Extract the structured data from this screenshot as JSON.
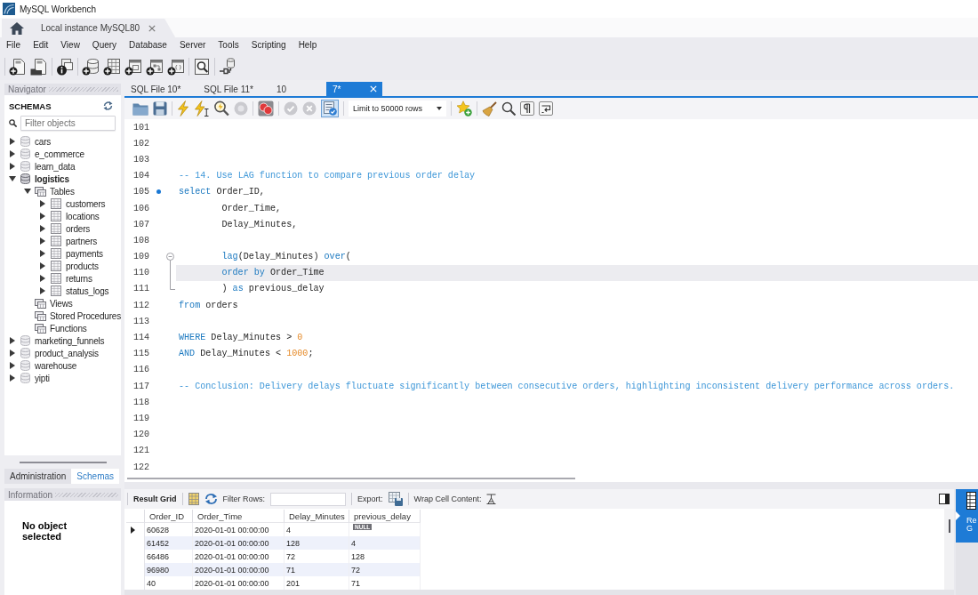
{
  "window": {
    "title": "MySQL Workbench"
  },
  "connection_tabs": [
    {
      "label": "Local instance MySQL80",
      "selected": true
    }
  ],
  "menu": [
    "File",
    "Edit",
    "View",
    "Query",
    "Database",
    "Server",
    "Tools",
    "Scripting",
    "Help"
  ],
  "navigator": {
    "title": "Navigator",
    "section_title": "SCHEMAS",
    "filter": {
      "placeholder": "Filter objects"
    },
    "schemas": [
      {
        "label": "cars",
        "kind": "schema",
        "expanded": false,
        "default": false
      },
      {
        "label": "e_commerce",
        "kind": "schema",
        "expanded": false,
        "default": false
      },
      {
        "label": "learn_data",
        "kind": "schema",
        "expanded": false,
        "default": false
      },
      {
        "label": "logistics",
        "kind": "schema",
        "expanded": true,
        "default": true,
        "children": [
          {
            "label": "Tables",
            "kind": "folder",
            "expanded": true,
            "children": [
              {
                "label": "customers",
                "kind": "table",
                "expanded": false
              },
              {
                "label": "locations",
                "kind": "table",
                "expanded": false
              },
              {
                "label": "orders",
                "kind": "table",
                "expanded": false
              },
              {
                "label": "partners",
                "kind": "table",
                "expanded": false
              },
              {
                "label": "payments",
                "kind": "table",
                "expanded": false
              },
              {
                "label": "products",
                "kind": "table",
                "expanded": false
              },
              {
                "label": "returns",
                "kind": "table",
                "expanded": false
              },
              {
                "label": "status_logs",
                "kind": "table",
                "expanded": false
              }
            ]
          },
          {
            "label": "Views",
            "kind": "empty-folder"
          },
          {
            "label": "Stored Procedures",
            "kind": "empty-folder"
          },
          {
            "label": "Functions",
            "kind": "empty-folder"
          }
        ]
      },
      {
        "label": "marketing_funnels",
        "kind": "schema",
        "expanded": false,
        "default": false
      },
      {
        "label": "product_analysis",
        "kind": "schema",
        "expanded": false,
        "default": false
      },
      {
        "label": "warehouse",
        "kind": "schema",
        "expanded": false,
        "default": false
      },
      {
        "label": "yipti",
        "kind": "schema",
        "expanded": false,
        "default": false
      }
    ],
    "bottom_tabs": [
      {
        "label": "Administration",
        "selected": false
      },
      {
        "label": "Schemas",
        "selected": true
      }
    ]
  },
  "information": {
    "title": "Information",
    "message": "No object selected"
  },
  "editor_tabs": [
    {
      "label": "SQL File 10*",
      "selected": false
    },
    {
      "label": "SQL File 11*",
      "selected": false
    },
    {
      "label": "10",
      "selected": false
    },
    {
      "label": "7*",
      "selected": true
    }
  ],
  "editor_toolbar": {
    "stop_disabled": true,
    "commit_disabled": true,
    "rollback_disabled": true,
    "autocommit_on": true,
    "row_limit": "Limit to 50000 rows"
  },
  "editor": {
    "lines": [
      {
        "number": "101",
        "kind": "plain",
        "current": false
      },
      {
        "number": "102",
        "kind": "plain",
        "current": false
      },
      {
        "number": "103",
        "kind": "plain",
        "current": false
      },
      {
        "number": "104",
        "kind": "plain",
        "current": false,
        "indented": false,
        "tokens": [
          {
            "kind": "comment",
            "text": "-- 14. Use LAG function to compare previous order delay"
          }
        ]
      },
      {
        "number": "105",
        "kind": "statement",
        "current": false,
        "indented": false,
        "tokens": [
          {
            "kind": "keyword",
            "text": "select"
          },
          {
            "kind": "plain",
            "text": " Order_ID,"
          }
        ]
      },
      {
        "number": "106",
        "kind": "plain",
        "current": false,
        "indented": true,
        "tokens": [
          {
            "kind": "plain",
            "text": "Order_Time,"
          }
        ]
      },
      {
        "number": "107",
        "kind": "plain",
        "current": false,
        "indented": true,
        "tokens": [
          {
            "kind": "plain",
            "text": "Delay_Minutes,"
          }
        ]
      },
      {
        "number": "108",
        "kind": "plain",
        "current": false
      },
      {
        "number": "109",
        "kind": "fold-start",
        "current": false,
        "indented": true,
        "tokens": [
          {
            "kind": "keyword",
            "text": "lag"
          },
          {
            "kind": "plain",
            "text": "(Delay_Minutes) "
          },
          {
            "kind": "keyword",
            "text": "over"
          },
          {
            "kind": "plain",
            "text": "("
          }
        ]
      },
      {
        "number": "110",
        "kind": "fold-body",
        "current": true,
        "indented": true,
        "tokens": [
          {
            "kind": "keyword",
            "text": "order by"
          },
          {
            "kind": "plain",
            "text": " Order_Time"
          }
        ]
      },
      {
        "number": "111",
        "kind": "fold-end",
        "current": false,
        "indented": true,
        "tokens": [
          {
            "kind": "plain",
            "text": ") "
          },
          {
            "kind": "keyword",
            "text": "as"
          },
          {
            "kind": "plain",
            "text": " previous_delay"
          }
        ]
      },
      {
        "number": "112",
        "kind": "plain",
        "current": false,
        "indented": false,
        "tokens": [
          {
            "kind": "keyword",
            "text": "from"
          },
          {
            "kind": "plain",
            "text": " orders"
          }
        ]
      },
      {
        "number": "113",
        "kind": "plain",
        "current": false
      },
      {
        "number": "114",
        "kind": "plain",
        "current": false,
        "indented": false,
        "tokens": [
          {
            "kind": "keyword",
            "text": "WHERE"
          },
          {
            "kind": "plain",
            "text": " Delay_Minutes > "
          },
          {
            "kind": "number",
            "text": "0"
          }
        ]
      },
      {
        "number": "115",
        "kind": "plain",
        "current": false,
        "indented": false,
        "tokens": [
          {
            "kind": "keyword",
            "text": "AND"
          },
          {
            "kind": "plain",
            "text": " Delay_Minutes < "
          },
          {
            "kind": "number",
            "text": "1000"
          },
          {
            "kind": "plain",
            "text": ";"
          }
        ]
      },
      {
        "number": "116",
        "kind": "plain",
        "current": false
      },
      {
        "number": "117",
        "kind": "plain",
        "current": false,
        "indented": false,
        "tokens": [
          {
            "kind": "comment",
            "text": "-- Conclusion: Delivery delays fluctuate significantly between consecutive orders, highlighting inconsistent delivery performance across orders."
          }
        ]
      },
      {
        "number": "118",
        "kind": "plain",
        "current": false
      },
      {
        "number": "119",
        "kind": "plain",
        "current": false
      },
      {
        "number": "120",
        "kind": "plain",
        "current": false
      },
      {
        "number": "121",
        "kind": "plain",
        "current": false
      },
      {
        "number": "122",
        "kind": "plain",
        "current": false
      }
    ]
  },
  "results": {
    "view_label": "Result Grid",
    "filter_label": "Filter Rows:",
    "export_label": "Export:",
    "wrap_label": "Wrap Cell Content:",
    "columns": [
      "Order_ID",
      "Order_Time",
      "Delay_Minutes",
      "previous_delay"
    ],
    "rows": [
      {
        "selected": true,
        "cells": [
          "60628",
          "2020-01-01 00:00:00",
          "4",
          {
            "kind": "null",
            "text": "NULL"
          }
        ]
      },
      {
        "selected": false,
        "cells": [
          "61452",
          "2020-01-01 00:00:00",
          "128",
          "4"
        ]
      },
      {
        "selected": false,
        "cells": [
          "66486",
          "2020-01-01 00:00:00",
          "72",
          "128"
        ]
      },
      {
        "selected": false,
        "cells": [
          "96980",
          "2020-01-01 00:00:00",
          "71",
          "72"
        ]
      },
      {
        "selected": false,
        "cells": [
          "40",
          "2020-01-01 00:00:00",
          "201",
          "71"
        ]
      }
    ],
    "side_tabs": [
      {
        "label_lines": [
          "Re",
          "G"
        ],
        "selected": true
      }
    ]
  }
}
